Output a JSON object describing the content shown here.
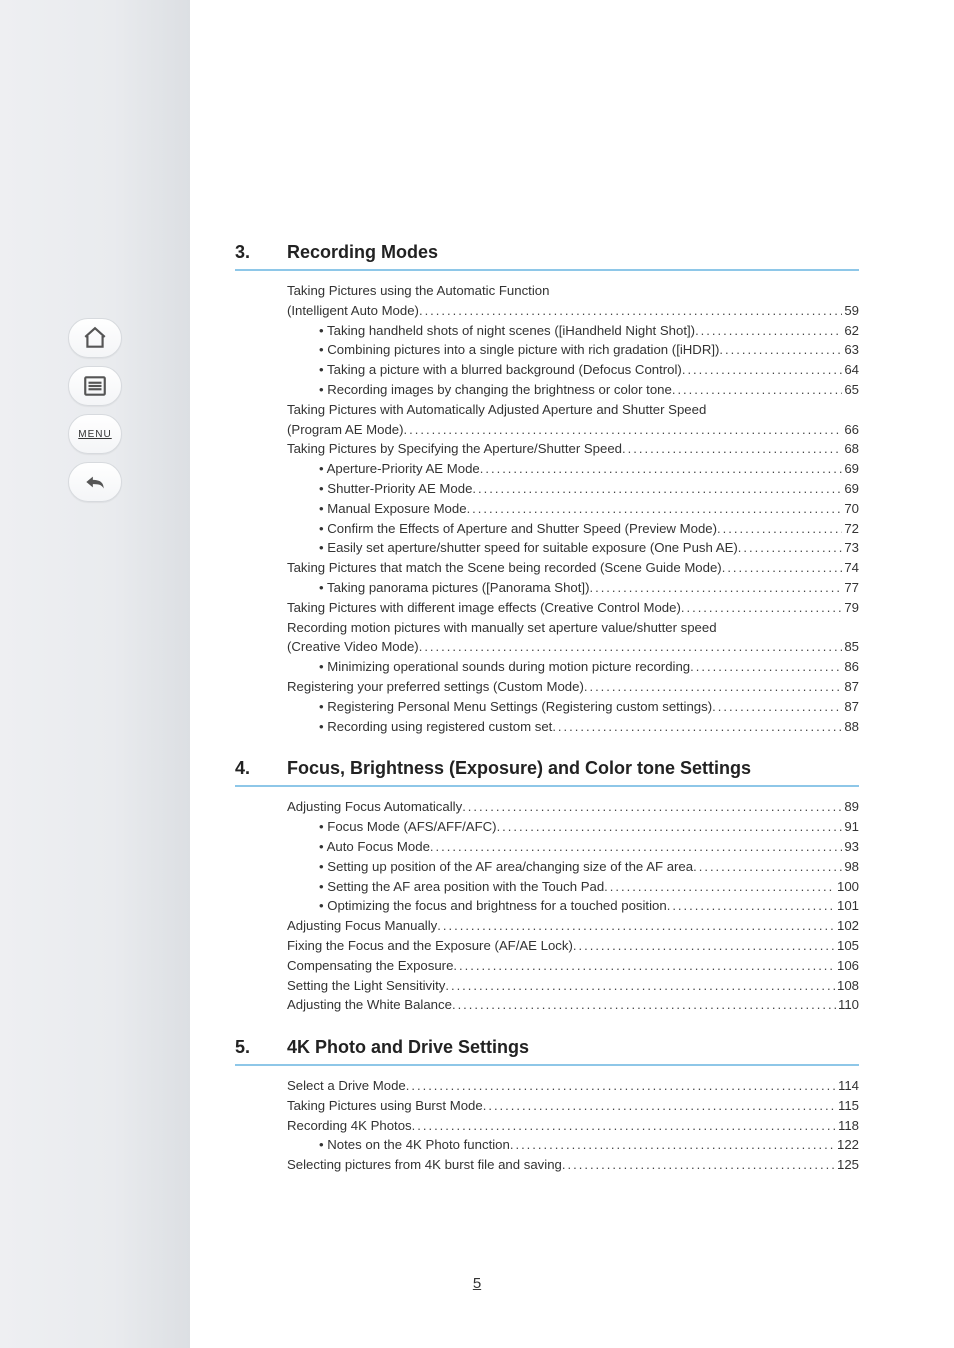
{
  "sidebar": {
    "items": [
      {
        "name": "nav-home",
        "icon": "home-icon"
      },
      {
        "name": "nav-contents",
        "icon": "list-icon"
      },
      {
        "name": "nav-menu",
        "icon": "menu-text",
        "label": "MENU"
      },
      {
        "name": "nav-back",
        "icon": "back-icon"
      }
    ]
  },
  "sections": [
    {
      "num": "3.",
      "title": "Recording Modes",
      "items": [
        {
          "label": "Taking Pictures using the Automatic Function",
          "page": "",
          "sub": false,
          "nopage": true
        },
        {
          "label": "(Intelligent Auto Mode)",
          "page": "59",
          "sub": false
        },
        {
          "label": "Taking handheld shots of night scenes ([iHandheld Night Shot])",
          "page": "62",
          "sub": true
        },
        {
          "label": "Combining pictures into a single picture with rich gradation ([iHDR])",
          "page": "63",
          "sub": true
        },
        {
          "label": "Taking a picture with a blurred background (Defocus Control)",
          "page": "64",
          "sub": true
        },
        {
          "label": "Recording images by changing the brightness or color tone",
          "page": "65",
          "sub": true
        },
        {
          "label": "Taking Pictures with Automatically Adjusted Aperture and Shutter Speed",
          "page": "",
          "sub": false,
          "nopage": true
        },
        {
          "label": "(Program AE Mode)",
          "page": "66",
          "sub": false
        },
        {
          "label": "Taking Pictures by Specifying the Aperture/Shutter Speed",
          "page": "68",
          "sub": false
        },
        {
          "label": "Aperture-Priority AE Mode",
          "page": "69",
          "sub": true
        },
        {
          "label": "Shutter-Priority AE Mode",
          "page": "69",
          "sub": true
        },
        {
          "label": "Manual Exposure Mode",
          "page": "70",
          "sub": true
        },
        {
          "label": "Confirm the Effects of Aperture and Shutter Speed (Preview Mode)",
          "page": "72",
          "sub": true
        },
        {
          "label": "Easily set aperture/shutter speed for suitable exposure (One Push AE)",
          "page": "73",
          "sub": true
        },
        {
          "label": "Taking Pictures that match the Scene being recorded (Scene Guide Mode)",
          "page": "74",
          "sub": false
        },
        {
          "label": "Taking panorama pictures ([Panorama Shot])",
          "page": "77",
          "sub": true
        },
        {
          "label": "Taking Pictures with different image effects (Creative Control Mode)",
          "page": "79",
          "sub": false
        },
        {
          "label": "Recording motion pictures with manually set aperture value/shutter speed",
          "page": "",
          "sub": false,
          "nopage": true
        },
        {
          "label": "(Creative Video Mode)",
          "page": "85",
          "sub": false
        },
        {
          "label": "Minimizing operational sounds during motion picture recording",
          "page": "86",
          "sub": true
        },
        {
          "label": "Registering your preferred settings (Custom Mode)",
          "page": "87",
          "sub": false
        },
        {
          "label": "Registering Personal Menu Settings (Registering custom settings)",
          "page": "87",
          "sub": true
        },
        {
          "label": "Recording using registered custom set",
          "page": "88",
          "sub": true
        }
      ]
    },
    {
      "num": "4.",
      "title": "Focus, Brightness (Exposure) and Color tone Settings",
      "items": [
        {
          "label": "Adjusting Focus Automatically",
          "page": "89",
          "sub": false
        },
        {
          "label": "Focus Mode (AFS/AFF/AFC)",
          "page": "91",
          "sub": true
        },
        {
          "label": "Auto Focus Mode",
          "page": "93",
          "sub": true
        },
        {
          "label": "Setting up position of the AF area/changing size of the AF area",
          "page": "98",
          "sub": true
        },
        {
          "label": "Setting the AF area position with the Touch Pad",
          "page": "100",
          "sub": true
        },
        {
          "label": "Optimizing the focus and brightness for a touched position",
          "page": "101",
          "sub": true
        },
        {
          "label": "Adjusting Focus Manually",
          "page": "102",
          "sub": false
        },
        {
          "label": "Fixing the Focus and the Exposure (AF/AE Lock)",
          "page": "105",
          "sub": false
        },
        {
          "label": "Compensating the Exposure",
          "page": "106",
          "sub": false
        },
        {
          "label": "Setting the Light Sensitivity",
          "page": "108",
          "sub": false
        },
        {
          "label": "Adjusting the White Balance",
          "page": "110",
          "sub": false
        }
      ]
    },
    {
      "num": "5.",
      "title": "4K Photo and Drive Settings",
      "items": [
        {
          "label": "Select a Drive Mode",
          "page": "114",
          "sub": false
        },
        {
          "label": "Taking Pictures using Burst Mode",
          "page": "115",
          "sub": false
        },
        {
          "label": "Recording 4K Photos",
          "page": "118",
          "sub": false
        },
        {
          "label": "Notes on the 4K Photo function",
          "page": "122",
          "sub": true
        },
        {
          "label": "Selecting pictures from 4K burst file and saving",
          "page": "125",
          "sub": false
        }
      ]
    }
  ],
  "footer": {
    "page_number": "5"
  }
}
